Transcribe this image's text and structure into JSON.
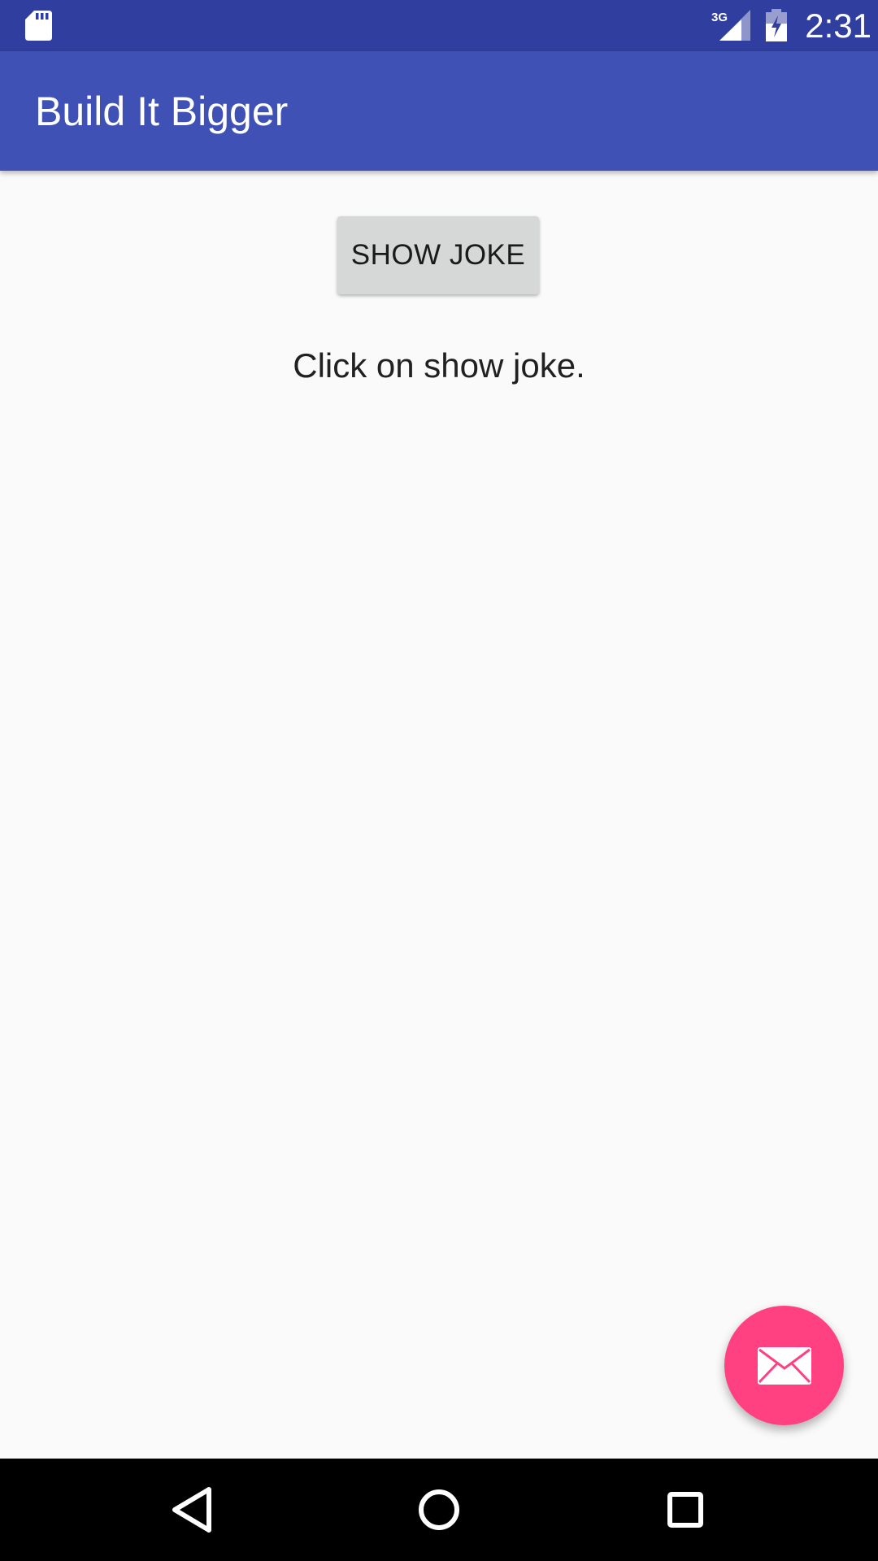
{
  "status_bar": {
    "network_type": "3G",
    "time": "2:31",
    "icons": [
      "sd-card-icon",
      "signal-3g-icon",
      "battery-charging-icon"
    ]
  },
  "app_bar": {
    "title": "Build It Bigger"
  },
  "main": {
    "show_joke_label": "SHOW JOKE",
    "hint_text": "Click on show joke."
  },
  "fab": {
    "icon": "mail-icon"
  },
  "nav_bar": {
    "icons": [
      "back-icon",
      "home-icon",
      "recents-icon"
    ]
  },
  "colors": {
    "status_bar": "#303F9F",
    "app_bar": "#3F51B5",
    "background": "#FAFAFA",
    "button": "#D6D7D7",
    "fab": "#FF4081",
    "nav_bar": "#000000"
  }
}
